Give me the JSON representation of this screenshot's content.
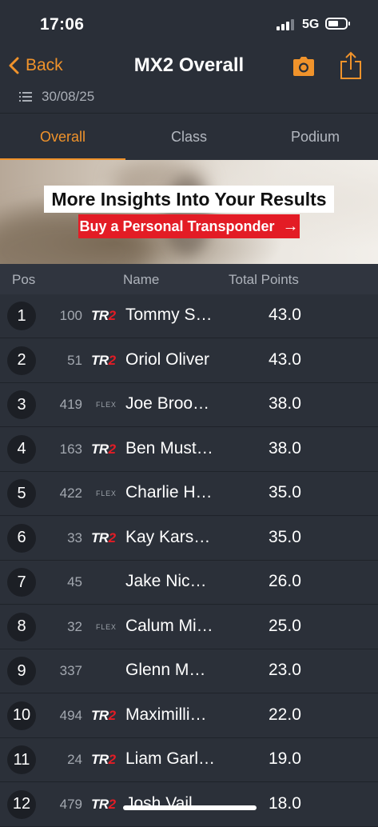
{
  "status_bar": {
    "time": "17:06",
    "network": "5G"
  },
  "nav": {
    "back_label": "Back",
    "title": "MX2 Overall"
  },
  "event_date": "30/08/25",
  "tabs": [
    {
      "label": "Overall",
      "active": true
    },
    {
      "label": "Class",
      "active": false
    },
    {
      "label": "Podium",
      "active": false
    }
  ],
  "banner": {
    "headline": "More Insights Into Your Results",
    "cta_label": "Buy a Personal Transponder",
    "cta_arrow": "→"
  },
  "table": {
    "headers": {
      "pos": "Pos",
      "name": "Name",
      "points": "Total Points"
    },
    "rows": [
      {
        "pos": "1",
        "number": "100",
        "transponder": "TR2",
        "name": "Tommy S…",
        "points": "43.0"
      },
      {
        "pos": "2",
        "number": "51",
        "transponder": "TR2",
        "name": "Oriol Oliver",
        "points": "43.0"
      },
      {
        "pos": "3",
        "number": "419",
        "transponder": "FLEX",
        "name": "Joe Broo…",
        "points": "38.0"
      },
      {
        "pos": "4",
        "number": "163",
        "transponder": "TR2",
        "name": "Ben Must…",
        "points": "38.0"
      },
      {
        "pos": "5",
        "number": "422",
        "transponder": "FLEX",
        "name": "Charlie H…",
        "points": "35.0"
      },
      {
        "pos": "6",
        "number": "33",
        "transponder": "TR2",
        "name": "Kay Kars…",
        "points": "35.0"
      },
      {
        "pos": "7",
        "number": "45",
        "transponder": "",
        "name": "Jake Nic…",
        "points": "26.0"
      },
      {
        "pos": "8",
        "number": "32",
        "transponder": "FLEX",
        "name": "Calum Mi…",
        "points": "25.0"
      },
      {
        "pos": "9",
        "number": "337",
        "transponder": "",
        "name": "Glenn M…",
        "points": "23.0"
      },
      {
        "pos": "10",
        "number": "494",
        "transponder": "TR2",
        "name": "Maximilli…",
        "points": "22.0"
      },
      {
        "pos": "11",
        "number": "24",
        "transponder": "TR2",
        "name": "Liam Garl…",
        "points": "19.0"
      },
      {
        "pos": "12",
        "number": "479",
        "transponder": "TR2",
        "name": "Josh Vail",
        "points": "18.0"
      }
    ]
  },
  "colors": {
    "accent": "#f0932b",
    "background": "#2a2f38",
    "cta": "#e31c25"
  }
}
